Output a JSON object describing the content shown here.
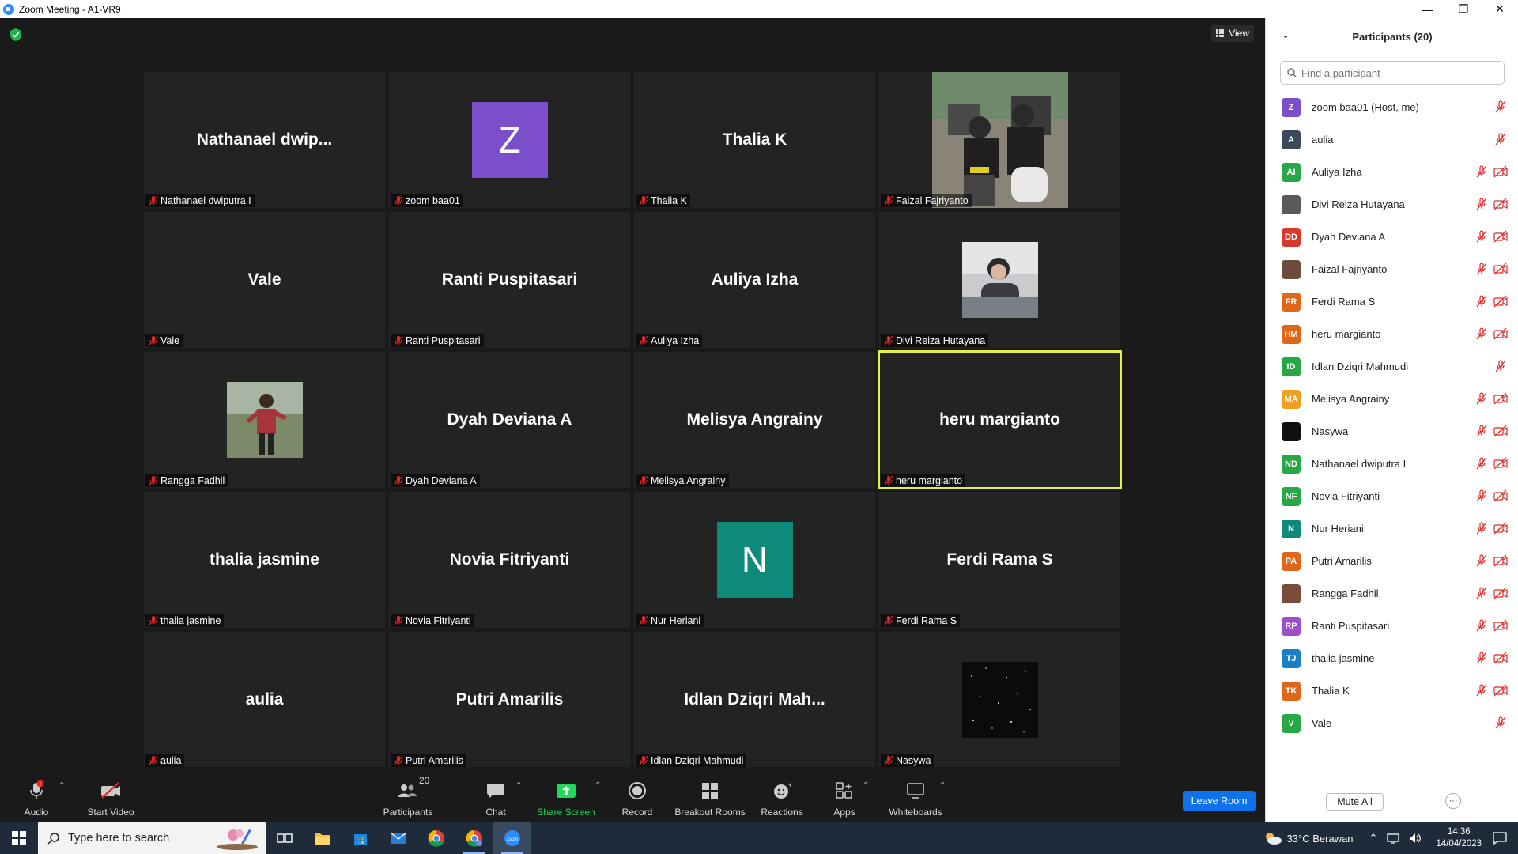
{
  "window": {
    "title": "Zoom Meeting - A1-VR9"
  },
  "meeting": {
    "view_label": "View"
  },
  "tiles": [
    {
      "big": "Nathanael  dwip...",
      "name": "Nathanael dwiputra I",
      "kind": "text"
    },
    {
      "big": "Z",
      "name": "zoom baa01",
      "kind": "avatar",
      "color": "#7b4fc9"
    },
    {
      "big": "Thalia K",
      "name": "Thalia K",
      "kind": "text"
    },
    {
      "big": "",
      "name": "Faizal Fajriyanto",
      "kind": "photo-scooter"
    },
    {
      "big": "Vale",
      "name": "Vale",
      "kind": "text"
    },
    {
      "big": "Ranti Puspitasari",
      "name": "Ranti Puspitasari",
      "kind": "text"
    },
    {
      "big": "Auliya Izha",
      "name": "Auliya Izha",
      "kind": "text"
    },
    {
      "big": "",
      "name": "Divi Reiza Hutayana",
      "kind": "photo-person"
    },
    {
      "big": "",
      "name": "Rangga Fadhil",
      "kind": "photo-outdoor"
    },
    {
      "big": "Dyah Deviana A",
      "name": "Dyah Deviana A",
      "kind": "text"
    },
    {
      "big": "Melisya Angrainy",
      "name": "Melisya Angrainy",
      "kind": "text"
    },
    {
      "big": "heru margianto",
      "name": "heru margianto",
      "kind": "text",
      "active": true
    },
    {
      "big": "thalia jasmine",
      "name": "thalia jasmine",
      "kind": "text"
    },
    {
      "big": "Novia Fitriyanti",
      "name": "Novia Fitriyanti",
      "kind": "text"
    },
    {
      "big": "N",
      "name": "Nur Heriani",
      "kind": "avatar",
      "color": "#0e8a7a"
    },
    {
      "big": "Ferdi Rama S",
      "name": "Ferdi Rama S",
      "kind": "text"
    },
    {
      "big": "aulia",
      "name": "aulia",
      "kind": "text"
    },
    {
      "big": "Putri Amarilis",
      "name": "Putri Amarilis",
      "kind": "text"
    },
    {
      "big": "Idlan Dziqri Mah...",
      "name": "Idlan Dziqri Mahmudi",
      "kind": "text"
    },
    {
      "big": "",
      "name": "Nasywa",
      "kind": "photo-stars"
    }
  ],
  "toolbar": {
    "audio": "Audio",
    "start_video": "Start Video",
    "participants": "Participants",
    "participants_count": "20",
    "chat": "Chat",
    "share_screen": "Share Screen",
    "record": "Record",
    "breakout_rooms": "Breakout Rooms",
    "reactions": "Reactions",
    "apps": "Apps",
    "whiteboards": "Whiteboards",
    "leave_room": "Leave Room"
  },
  "panel": {
    "title": "Participants (20)",
    "search_placeholder": "Find a participant",
    "mute_all": "Mute All",
    "more": "···",
    "participants": [
      {
        "initials": "Z",
        "name": "zoom baa01 (Host, me)",
        "color": "#7b4fc9",
        "video_off": false
      },
      {
        "initials": "A",
        "name": "aulia",
        "color": "#3b4a5a",
        "video_off": false
      },
      {
        "initials": "AI",
        "name": "Auliya Izha",
        "color": "#27a844",
        "video_off": true
      },
      {
        "initials": "",
        "name": "Divi Reiza Hutayana",
        "color": "#5a5a5a",
        "video_off": true,
        "photo": true
      },
      {
        "initials": "DD",
        "name": "Dyah Deviana A",
        "color": "#d7392b",
        "video_off": true
      },
      {
        "initials": "",
        "name": "Faizal Fajriyanto",
        "color": "#6b4c3b",
        "video_off": true,
        "photo": true
      },
      {
        "initials": "FR",
        "name": "Ferdi Rama S",
        "color": "#e0661a",
        "video_off": true
      },
      {
        "initials": "HM",
        "name": "heru margianto",
        "color": "#e0661a",
        "video_off": true
      },
      {
        "initials": "ID",
        "name": "Idlan Dziqri Mahmudi",
        "color": "#27a844",
        "video_off": false
      },
      {
        "initials": "MA",
        "name": "Melisya Angrainy",
        "color": "#f0a020",
        "video_off": true
      },
      {
        "initials": "",
        "name": "Nasywa",
        "color": "#111111",
        "video_off": true,
        "photo": true
      },
      {
        "initials": "ND",
        "name": "Nathanael dwiputra I",
        "color": "#27a844",
        "video_off": true
      },
      {
        "initials": "NF",
        "name": "Novia Fitriyanti",
        "color": "#27a844",
        "video_off": true
      },
      {
        "initials": "N",
        "name": "Nur Heriani",
        "color": "#0e8a7a",
        "video_off": true
      },
      {
        "initials": "PA",
        "name": "Putri Amarilis",
        "color": "#e0661a",
        "video_off": true
      },
      {
        "initials": "",
        "name": "Rangga Fadhil",
        "color": "#7a4a3a",
        "video_off": true,
        "photo": true
      },
      {
        "initials": "RP",
        "name": "Ranti Puspitasari",
        "color": "#9b4fc9",
        "video_off": true
      },
      {
        "initials": "TJ",
        "name": "thalia jasmine",
        "color": "#1a7fc4",
        "video_off": true
      },
      {
        "initials": "TK",
        "name": "Thalia K",
        "color": "#e0661a",
        "video_off": true
      },
      {
        "initials": "V",
        "name": "Vale",
        "color": "#27a844",
        "video_off": false
      }
    ]
  },
  "taskbar": {
    "search_placeholder": "Type here to search",
    "weather": "33°C  Berawan",
    "time": "14:36",
    "date": "14/04/2023"
  },
  "colors": {
    "accent_blue": "#0e72ed",
    "share_green": "#23d959",
    "active_speaker": "#e3f145",
    "mute_red": "#e02828"
  }
}
